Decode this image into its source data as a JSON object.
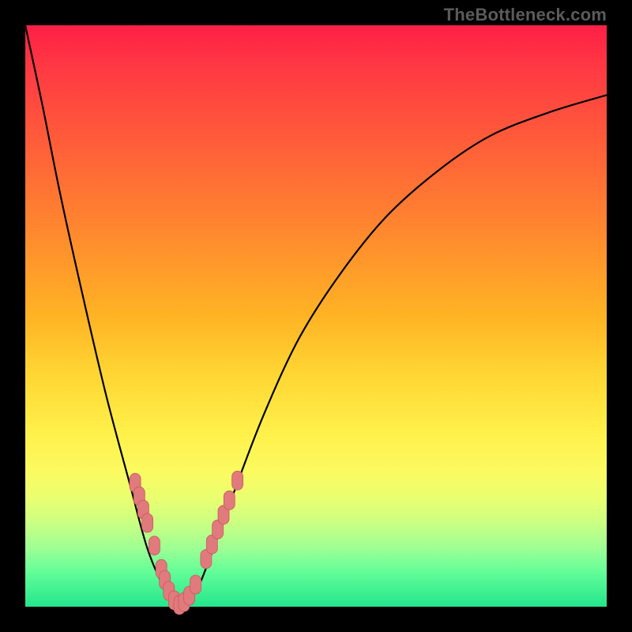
{
  "watermark": "TheBottleneck.com",
  "colors": {
    "frame": "#000000",
    "gradient_top": "#ff1f45",
    "gradient_mid": "#ffd633",
    "gradient_bottom": "#24e68c",
    "curve": "#000000",
    "marker_fill": "#e07a7c",
    "marker_stroke": "#c85a5f"
  },
  "chart_data": {
    "type": "line",
    "title": "",
    "xlabel": "",
    "ylabel": "",
    "xlim": [
      0,
      1
    ],
    "ylim": [
      0,
      1
    ],
    "note": "Axes are unitless/normalized; no tick labels are shown in the source image. Curve values estimated from gridless pixels.",
    "series": [
      {
        "name": "bottleneck-curve",
        "x": [
          0.0,
          0.03,
          0.06,
          0.1,
          0.14,
          0.18,
          0.21,
          0.24,
          0.26,
          0.29,
          0.32,
          0.36,
          0.41,
          0.47,
          0.54,
          0.62,
          0.71,
          0.8,
          0.9,
          1.0
        ],
        "y": [
          1.0,
          0.86,
          0.71,
          0.53,
          0.36,
          0.21,
          0.1,
          0.03,
          0.0,
          0.02,
          0.09,
          0.2,
          0.33,
          0.46,
          0.57,
          0.67,
          0.75,
          0.81,
          0.85,
          0.88
        ]
      }
    ],
    "markers": [
      {
        "x": 0.189,
        "y": 0.213
      },
      {
        "x": 0.196,
        "y": 0.19
      },
      {
        "x": 0.203,
        "y": 0.167
      },
      {
        "x": 0.21,
        "y": 0.144
      },
      {
        "x": 0.222,
        "y": 0.105
      },
      {
        "x": 0.234,
        "y": 0.065
      },
      {
        "x": 0.24,
        "y": 0.046
      },
      {
        "x": 0.247,
        "y": 0.027
      },
      {
        "x": 0.256,
        "y": 0.011
      },
      {
        "x": 0.265,
        "y": 0.003
      },
      {
        "x": 0.273,
        "y": 0.008
      },
      {
        "x": 0.282,
        "y": 0.019
      },
      {
        "x": 0.293,
        "y": 0.038
      },
      {
        "x": 0.311,
        "y": 0.082
      },
      {
        "x": 0.321,
        "y": 0.107
      },
      {
        "x": 0.331,
        "y": 0.133
      },
      {
        "x": 0.341,
        "y": 0.158
      },
      {
        "x": 0.351,
        "y": 0.183
      },
      {
        "x": 0.365,
        "y": 0.217
      }
    ]
  }
}
